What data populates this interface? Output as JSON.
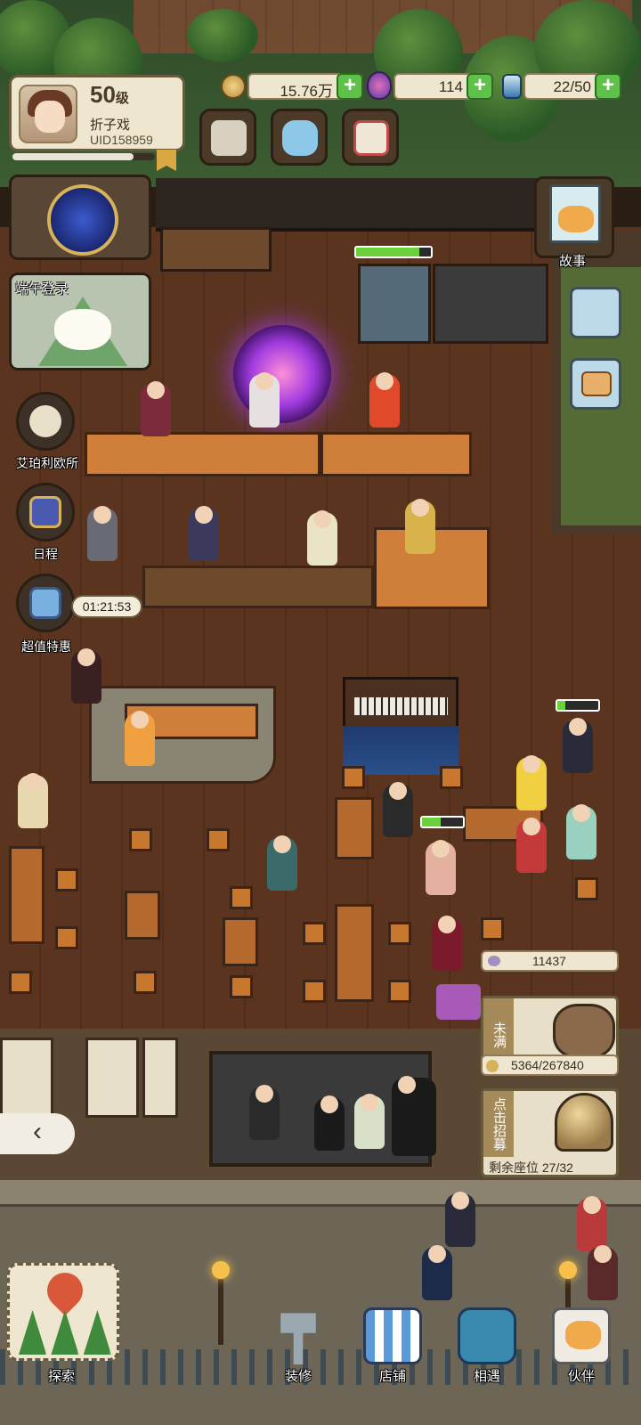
{
  "player": {
    "level": "50",
    "level_unit": "级",
    "name": "折子戏",
    "uid": "UID158959",
    "xp_progress": 0.85
  },
  "resources": {
    "coins": "15.76万",
    "gems": "114",
    "energy": "22/50"
  },
  "events": {
    "dragon_boat_label": "端午登录"
  },
  "side_menu": {
    "apollo_label": "艾珀利欧所",
    "schedule_label": "日程",
    "deal_label": "超值特惠",
    "deal_timer": "01:21:53"
  },
  "right_menu": {
    "story_label": "故事"
  },
  "shop_panel": {
    "points": "11437",
    "piggy_tag": "未满",
    "piggy_progress": "5364/267840",
    "recruit_tag": "点击招募",
    "seats": "剩余座位 27/32"
  },
  "nav": {
    "back_icon": "‹",
    "explore": "探索",
    "decorate": "装修",
    "shop": "店铺",
    "encounter": "相遇",
    "partner": "伙伴"
  },
  "gauges": {
    "stove": 0.85,
    "table": 0.45,
    "guest": 0.2
  },
  "colors": {
    "accent_green": "#5fc04a",
    "panel_cream": "#efe6cf",
    "wood_dark": "#3e2414"
  }
}
